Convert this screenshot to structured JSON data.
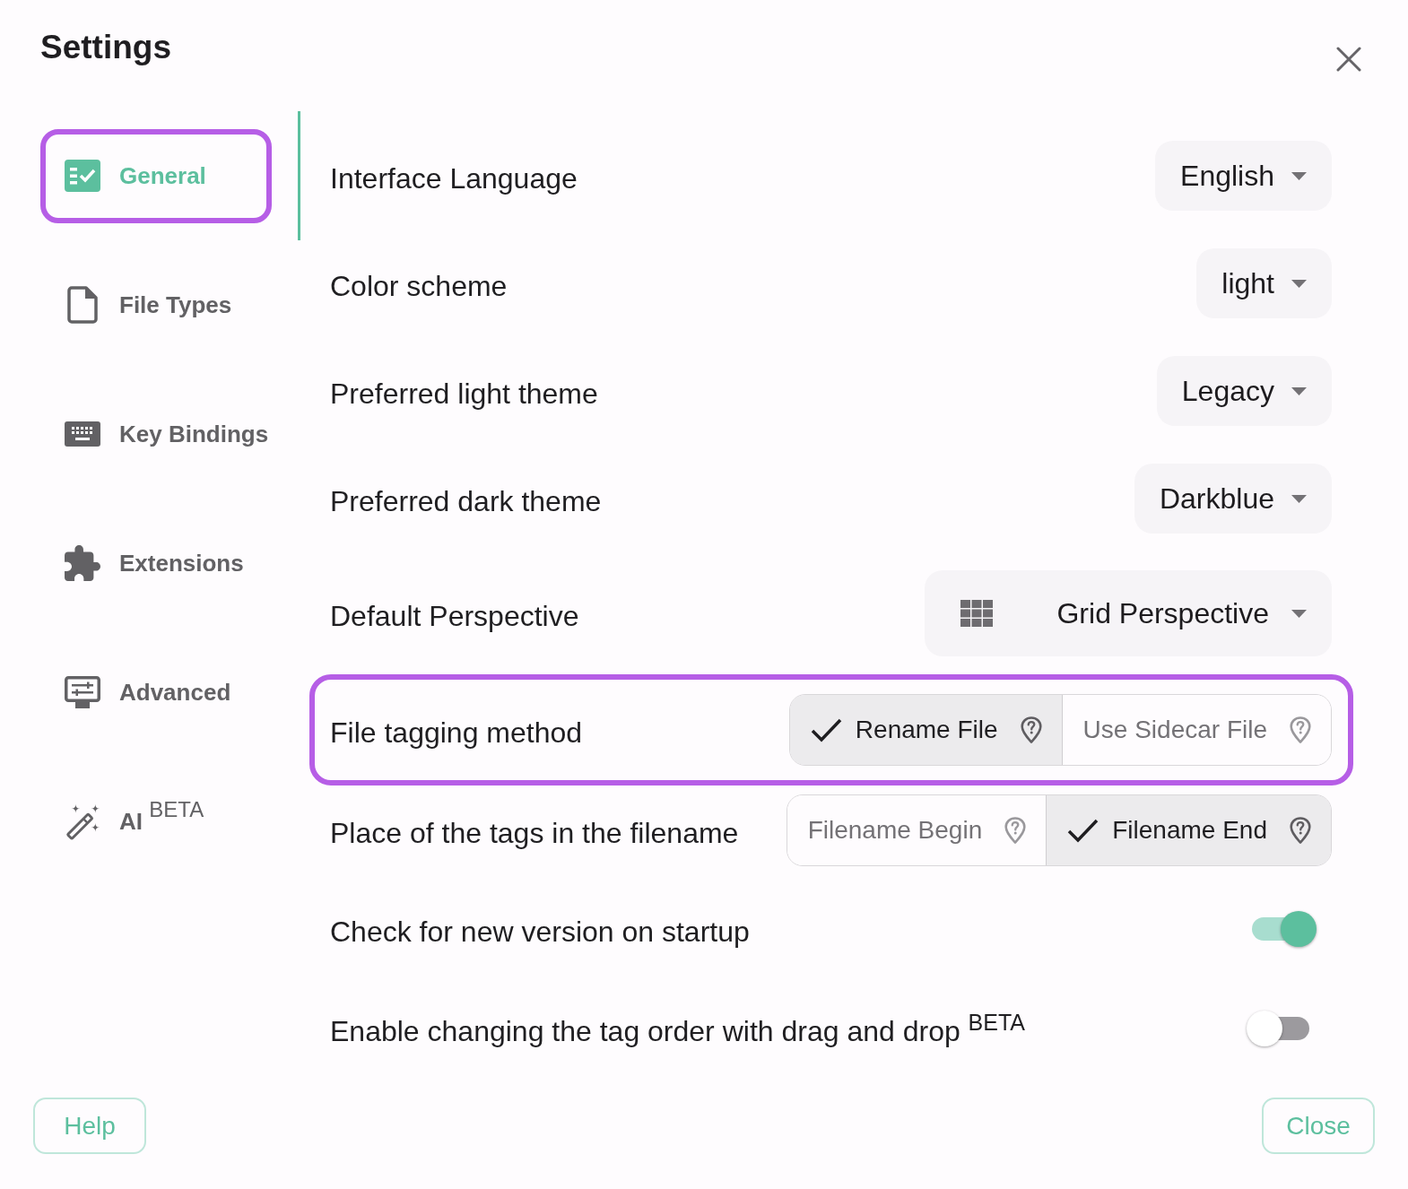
{
  "window": {
    "title": "Settings"
  },
  "sidebar": {
    "items": [
      {
        "label": "General",
        "selected": true,
        "highlighted": true
      },
      {
        "label": "File Types",
        "selected": false,
        "highlighted": false
      },
      {
        "label": "Key Bindings",
        "selected": false,
        "highlighted": false
      },
      {
        "label": "Extensions",
        "selected": false,
        "highlighted": false
      },
      {
        "label": "Advanced",
        "selected": false,
        "highlighted": false
      },
      {
        "label": "AI $^{BETA}$",
        "selected": false,
        "highlighted": false
      }
    ]
  },
  "settings": [
    {
      "kind": "dropdown",
      "label": "Interface Language",
      "value": "English",
      "highlighted": false
    },
    {
      "kind": "dropdown",
      "label": "Color scheme",
      "value": "light",
      "highlighted": false
    },
    {
      "kind": "dropdown",
      "label": "Preferred light theme",
      "value": "Legacy",
      "highlighted": false
    },
    {
      "kind": "dropdown",
      "label": "Preferred dark theme",
      "value": "Darkblue",
      "highlighted": false
    },
    {
      "kind": "icondropdown",
      "label": "Default Perspective",
      "value": "Grid Perspective",
      "highlighted": false
    },
    {
      "kind": "segmented",
      "label": "File tagging method",
      "highlighted": true,
      "options": [
        {
          "label": "Rename File",
          "selected": true
        },
        {
          "label": "Use Sidecar File",
          "selected": false
        }
      ]
    },
    {
      "kind": "segmented",
      "label": "Place of the tags in the filename",
      "highlighted": false,
      "options": [
        {
          "label": "Filename Begin",
          "selected": false
        },
        {
          "label": "Filename End",
          "selected": true
        }
      ]
    },
    {
      "kind": "switch",
      "label": "Check for new version on startup",
      "on": true,
      "highlighted": false
    },
    {
      "kind": "switch",
      "label": "Enable changing the tag order with drag and drop $^{BETA}$",
      "on": false,
      "highlighted": false
    }
  ],
  "footer": {
    "buttons": [
      "Help",
      "Close"
    ]
  }
}
